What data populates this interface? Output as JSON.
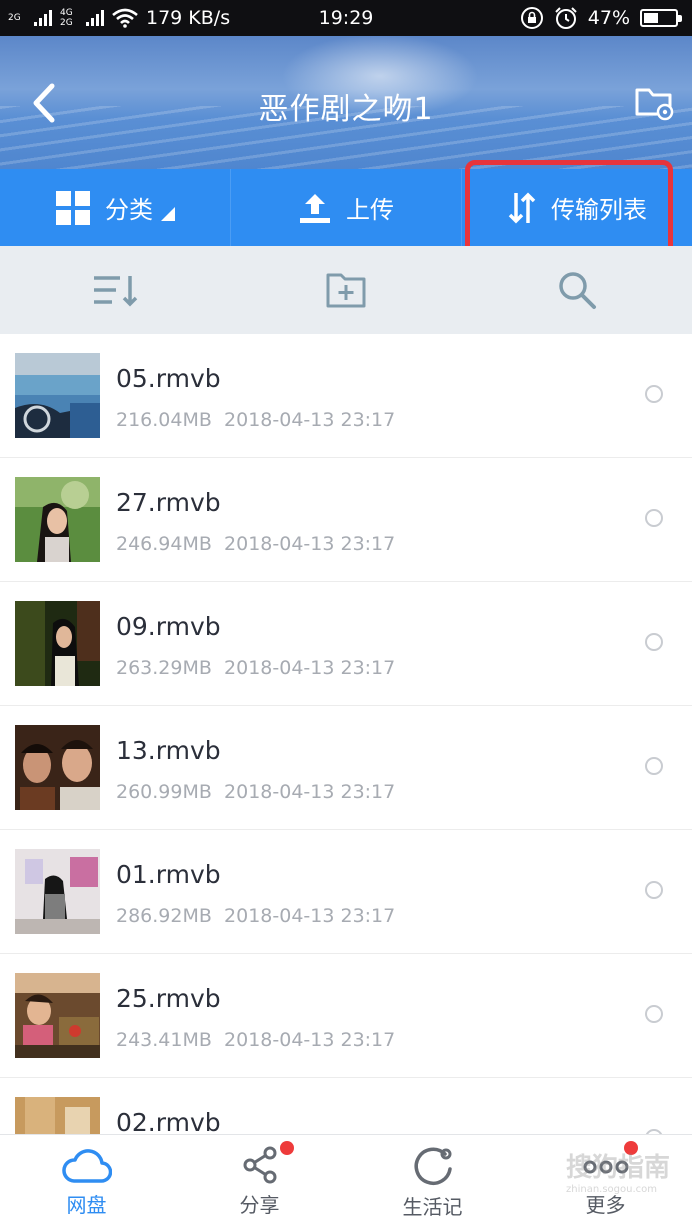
{
  "status_bar": {
    "sim1": "2G",
    "sim2_top": "4G",
    "sim2_bottom": "2G",
    "speed": "179 KB/s",
    "time": "19:29",
    "battery_text": "47%",
    "battery_level": 0.47
  },
  "header": {
    "title": "恶作剧之吻1"
  },
  "toolbar": {
    "category_label": "分类",
    "upload_label": "上传",
    "transfer_label": "传输列表"
  },
  "files": [
    {
      "name": "05.rmvb",
      "size": "216.04MB",
      "date": "2018-04-13 23:17"
    },
    {
      "name": "27.rmvb",
      "size": "246.94MB",
      "date": "2018-04-13 23:17"
    },
    {
      "name": "09.rmvb",
      "size": "263.29MB",
      "date": "2018-04-13 23:17"
    },
    {
      "name": "13.rmvb",
      "size": "260.99MB",
      "date": "2018-04-13 23:17"
    },
    {
      "name": "01.rmvb",
      "size": "286.92MB",
      "date": "2018-04-13 23:17"
    },
    {
      "name": "25.rmvb",
      "size": "243.41MB",
      "date": "2018-04-13 23:17"
    },
    {
      "name": "02.rmvb",
      "size": "",
      "date": ""
    }
  ],
  "bottom_nav": {
    "netdisk": "网盘",
    "share": "分享",
    "life": "生活记",
    "more": "更多"
  },
  "watermark": {
    "brand": "搜狗指南",
    "domain": "zhinan.sogou.com"
  },
  "colors": {
    "accent": "#2f8df2",
    "highlight": "#e8343b",
    "badge": "#ee3b3b"
  }
}
